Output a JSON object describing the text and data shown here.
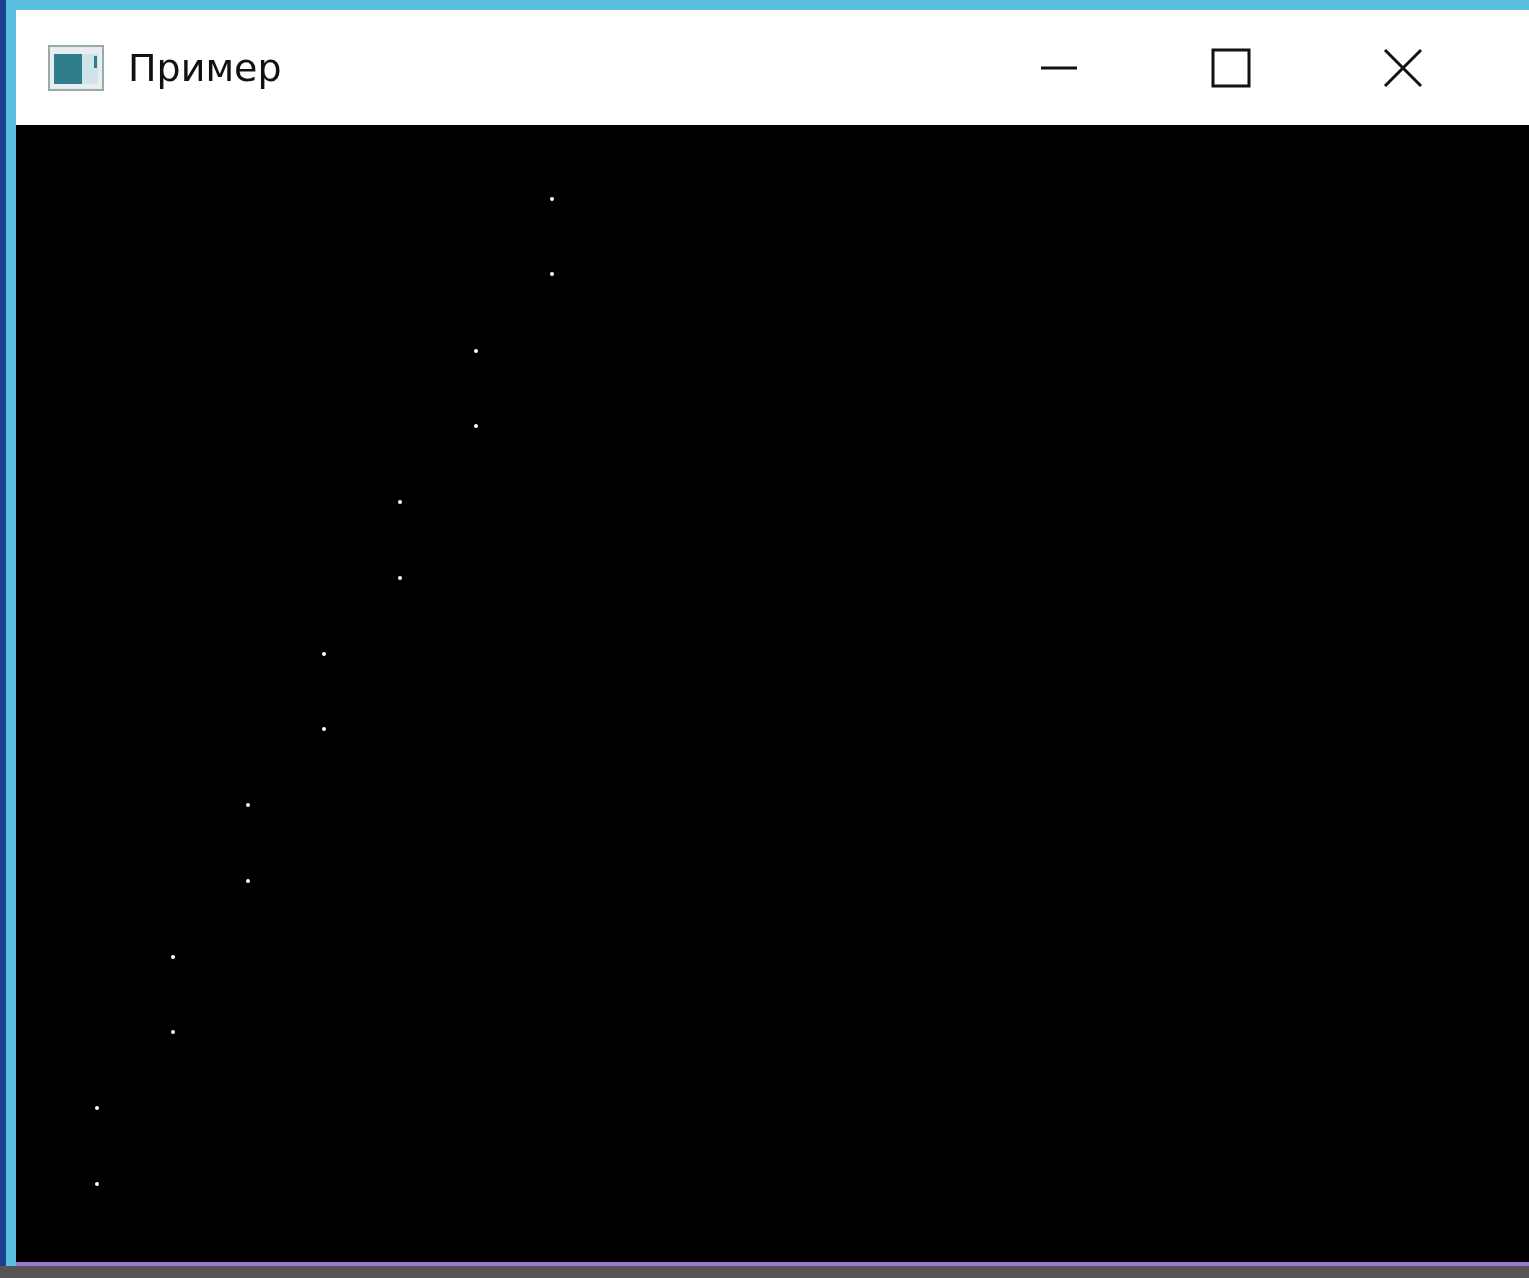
{
  "window": {
    "title": "Пример"
  }
}
